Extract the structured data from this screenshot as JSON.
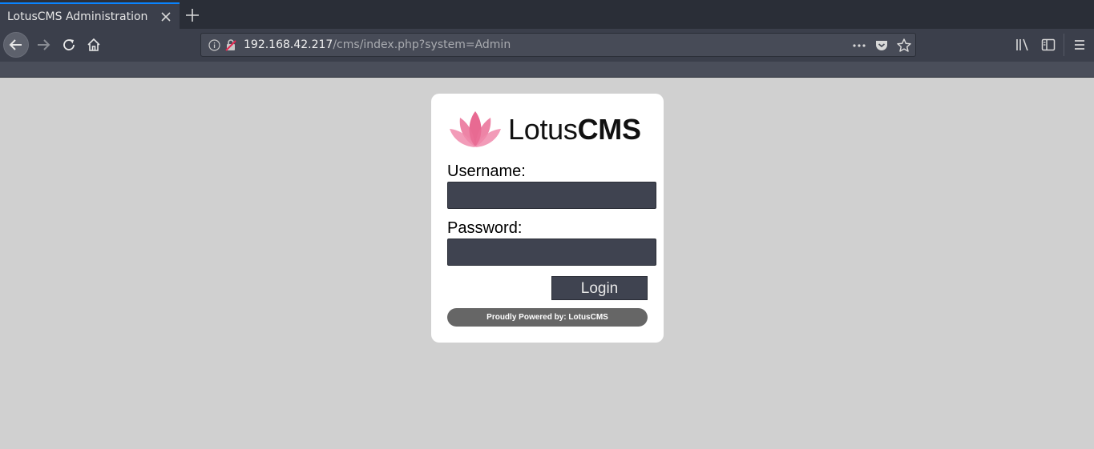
{
  "browser": {
    "tab": {
      "title": "LotusCMS Administration"
    },
    "url": {
      "host": "192.168.42.217",
      "path": "/cms/index.php?system=Admin"
    }
  },
  "login": {
    "logo": {
      "text_regular": "Lotus",
      "text_bold": "CMS"
    },
    "username": {
      "label": "Username:",
      "value": ""
    },
    "password": {
      "label": "Password:",
      "value": ""
    },
    "login_button": "Login",
    "powered_by": "Proudly Powered by: LotusCMS"
  },
  "colors": {
    "accent": "#0a84ff",
    "lotus_pink": "#e55a86",
    "input_bg": "#3f4350",
    "page_bg": "#d0d0d0"
  }
}
